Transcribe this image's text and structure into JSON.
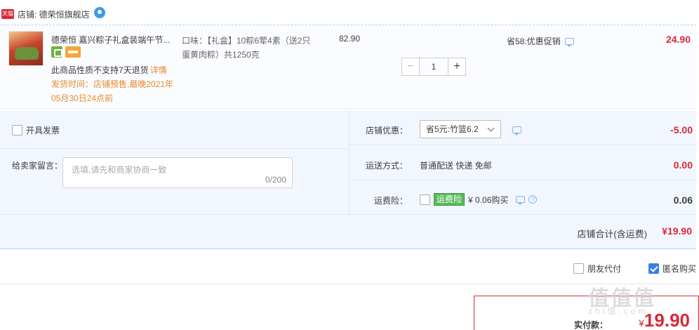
{
  "shop": {
    "badge": "天猫",
    "label": "店铺: 德荣恒旗舰店"
  },
  "item": {
    "title": "德荣恒 嘉兴粽子礼盒装端午节...",
    "no_return": "此商品性质不支持7天退货",
    "detail_link": "详情",
    "ship_time": "发货时间：店铺预售,最晚2021年05月30日24点前",
    "sku": "口味：【礼盒】10粽6荤4素（送2只蛋黄肉粽）共1250克",
    "unit_price": "82.90",
    "quantity": "1",
    "minus": "−",
    "plus": "+",
    "promo": "省58:优惠促销",
    "total": "24.90"
  },
  "options": {
    "invoice_label": "开具发票",
    "message_label": "给卖家留言：",
    "message_placeholder": "选填,请先和商家协商一致",
    "message_count": "0/200",
    "shop_discount_label": "店铺优惠：",
    "shop_discount_value": "省5元:竹篮6.2",
    "shop_discount_amount": "-5.00",
    "shipping_label": "运送方式：",
    "shipping_value": "普通配送 快递 免邮",
    "shipping_amount": "0.00",
    "insurance_label": "运费险：",
    "insurance_tag": "运费险",
    "insurance_text": "¥ 0.06购买",
    "insurance_help": "?",
    "insurance_amount": "0.06",
    "shop_total_label": "店铺合计(含运费)",
    "shop_total_value": "¥19.90"
  },
  "payment": {
    "friend_pay": "朋友代付",
    "anonymous": "匿名购买",
    "actual_label": "实付款：",
    "currency": "¥",
    "actual_amount": "19.90"
  },
  "watermark": {
    "main": "值值值",
    "sub": "zhi值.com"
  },
  "colors": {
    "accent_red": "#d8293a",
    "accent_orange": "#e38b2f",
    "link_blue": "#3a7fe0",
    "panel_bg": "#f2f7ff"
  }
}
